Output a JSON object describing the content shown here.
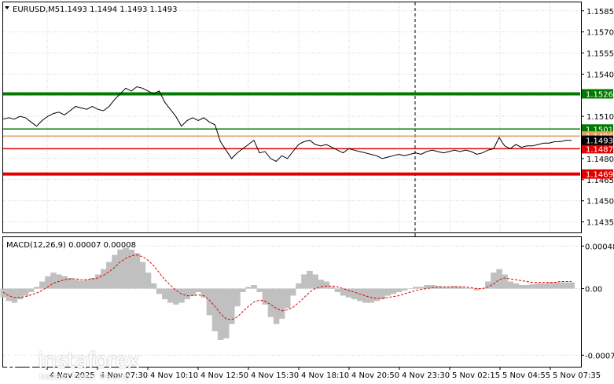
{
  "header": {
    "symbol": "EURUSD,M5",
    "ohlc": "1.1493 1.1494 1.1493 1.1493",
    "indicator": "MACD(12,26,9) 0.00007 0.00008"
  },
  "logo": {
    "brand": "instaforex",
    "tagline": "Instant Forex Trading"
  },
  "colors": {
    "green_level": "#007a00",
    "red_level": "#e00000",
    "price_line": "#000000",
    "histogram": "#c0c0c0",
    "signal": "#e00000",
    "current_price_bg": "#000000",
    "grid": "#c8c8c8"
  },
  "chart_data": [
    {
      "type": "line",
      "series": [
        {
          "values": [
            1.1508,
            1.1509,
            1.1508,
            1.151,
            1.1509,
            1.1506,
            1.1503,
            1.1507,
            1.151,
            1.1512,
            1.1513,
            1.1511,
            1.1514,
            1.1517,
            1.1516,
            1.1515,
            1.1517,
            1.1515,
            1.1514,
            1.1517,
            1.1522,
            1.1526,
            1.153,
            1.1528,
            1.1531,
            1.153,
            1.1528,
            1.1526,
            1.1528,
            1.152,
            1.1515,
            1.151,
            1.1503,
            1.1507,
            1.1509,
            1.1507,
            1.1509,
            1.1506,
            1.1504,
            1.1492,
            1.1486,
            1.148,
            1.1484,
            1.1487,
            1.149,
            1.1493,
            1.1484,
            1.1485,
            1.148,
            1.1478,
            1.1482,
            1.148,
            1.1485,
            1.149,
            1.1492,
            1.1493,
            1.149,
            1.1489,
            1.149,
            1.1488,
            1.1486,
            1.1484,
            1.1487,
            1.1486,
            1.1485,
            1.1484,
            1.1483,
            1.1482,
            1.148,
            1.1481,
            1.1482,
            1.1483,
            1.1482,
            1.1483,
            1.1484,
            1.1483,
            1.1485,
            1.1486,
            1.1485,
            1.1484,
            1.1485,
            1.1486,
            1.1485,
            1.1486,
            1.1485,
            1.1483,
            1.1484,
            1.1486,
            1.1487,
            1.1495,
            1.1489,
            1.1487,
            1.149,
            1.1488,
            1.1489,
            1.1489,
            1.149,
            1.1491,
            1.1491,
            1.1492,
            1.1492,
            1.1493,
            1.1493
          ]
        }
      ],
      "ylim": [
        1.14275,
        1.1591
      ],
      "y_ticks": [
        "1.1585",
        "1.1570",
        "1.1555",
        "1.1540",
        "1.1525",
        "1.1510",
        "1.1495",
        "1.1480",
        "1.1465",
        "1.1450",
        "1.1435"
      ],
      "y_tick_values": [
        1.1585,
        1.157,
        1.1555,
        1.154,
        1.1525,
        1.151,
        1.1495,
        1.148,
        1.1465,
        1.145,
        1.1435
      ],
      "levels": [
        {
          "price": 1.1526,
          "label": "1.1526",
          "color": "green",
          "style": "thick"
        },
        {
          "price": 1.1501,
          "label": "1.1501",
          "color": "green",
          "style": "thin"
        },
        {
          "price": 1.1496,
          "label": "1.1496",
          "color": "orange",
          "style": "thin"
        },
        {
          "price": 1.1487,
          "label": "1.1487",
          "color": "red",
          "style": "thin"
        },
        {
          "price": 1.1469,
          "label": "1.1469",
          "color": "red",
          "style": "thick"
        }
      ],
      "current_price": "1.1493",
      "grid": true
    },
    {
      "type": "bar",
      "title": "MACD(12,26,9) 0.00007 0.00008",
      "histogram": [
        -0.0001,
        -0.00014,
        -0.00016,
        -0.00012,
        -8e-05,
        -4e-05,
        2e-05,
        8e-05,
        0.00014,
        0.00018,
        0.00016,
        0.00014,
        0.00012,
        0.0001,
        9e-05,
        0.0001,
        0.00012,
        0.00016,
        0.00022,
        0.0003,
        0.00038,
        0.00044,
        0.00046,
        0.00044,
        0.0004,
        0.0003,
        0.00018,
        6e-05,
        -6e-05,
        -0.00012,
        -0.00016,
        -0.00018,
        -0.00016,
        -0.00012,
        -8e-05,
        -4e-05,
        -0.0001,
        -0.0003,
        -0.00048,
        -0.00058,
        -0.00056,
        -0.0004,
        -0.0002,
        -4e-05,
        2e-05,
        4e-05,
        -4e-05,
        -0.00018,
        -0.00032,
        -0.0004,
        -0.00034,
        -0.00022,
        -8e-05,
        6e-05,
        0.00016,
        0.0002,
        0.00016,
        0.0001,
        8e-05,
        2e-05,
        -4e-05,
        -8e-05,
        -0.0001,
        -0.00012,
        -0.00014,
        -0.00016,
        -0.00016,
        -0.00014,
        -0.00012,
        -8e-05,
        -6e-05,
        -4e-05,
        -2e-05,
        0.0,
        2e-05,
        2e-05,
        4e-05,
        4e-05,
        3e-05,
        2e-05,
        2e-05,
        3e-05,
        2e-05,
        1e-05,
        0.0,
        -2e-05,
        0.0,
        8e-05,
        0.00018,
        0.00022,
        0.00016,
        8e-05,
        6e-05,
        4e-05,
        4e-05,
        5e-05,
        6e-05,
        6e-05,
        7e-05,
        7e-05,
        7e-05,
        7e-05,
        7e-05
      ],
      "signal": [
        -4e-05,
        -8e-05,
        -0.0001,
        -0.0001,
        -9e-05,
        -7e-05,
        -5e-05,
        -2e-05,
        2e-05,
        6e-05,
        8e-05,
        0.0001,
        0.00011,
        0.00011,
        0.0001,
        0.0001,
        0.00011,
        0.00012,
        0.00015,
        0.00019,
        0.00024,
        0.0003,
        0.00034,
        0.00037,
        0.00038,
        0.00036,
        0.00032,
        0.00026,
        0.00018,
        0.0001,
        4e-05,
        -2e-05,
        -6e-05,
        -8e-05,
        -8e-05,
        -7e-05,
        -8e-05,
        -0.00013,
        -0.0002,
        -0.00028,
        -0.00034,
        -0.00035,
        -0.00032,
        -0.00026,
        -0.0002,
        -0.00015,
        -0.00013,
        -0.00014,
        -0.00018,
        -0.00022,
        -0.00025,
        -0.00024,
        -0.00021,
        -0.00016,
        -0.0001,
        -4e-05,
        0.0,
        2e-05,
        3e-05,
        3e-05,
        2e-05,
        0.0,
        -2e-05,
        -4e-05,
        -6e-05,
        -8e-05,
        -0.0001,
        -0.00011,
        -0.00011,
        -0.0001,
        -9e-05,
        -8e-05,
        -6e-05,
        -4e-05,
        -2e-05,
        -1e-05,
        0.0,
        1e-05,
        2e-05,
        2e-05,
        2e-05,
        2e-05,
        2e-05,
        2e-05,
        1e-05,
        0.0,
        0.0,
        2e-05,
        5e-05,
        0.0001,
        0.00012,
        0.00011,
        0.0001,
        9e-05,
        8e-05,
        7e-05,
        7e-05,
        7e-05,
        7e-05,
        7e-05,
        8e-05,
        8e-05,
        8e-05
      ],
      "ylim": [
        -0.00088,
        0.00058
      ],
      "y_ticks": [
        "0.00048",
        "0.00",
        "-0.00075"
      ],
      "y_tick_values": [
        0.00048,
        0.0,
        -0.00075
      ]
    }
  ],
  "x_axis": {
    "labels": [
      "4 Nov 2025",
      "4 Nov 07:30",
      "4 Nov 10:10",
      "4 Nov 12:50",
      "4 Nov 15:30",
      "4 Nov 18:10",
      "4 Nov 20:50",
      "4 Nov 23:30",
      "5 Nov 02:15",
      "5 Nov 04:55",
      "5 Nov 07:35"
    ]
  }
}
